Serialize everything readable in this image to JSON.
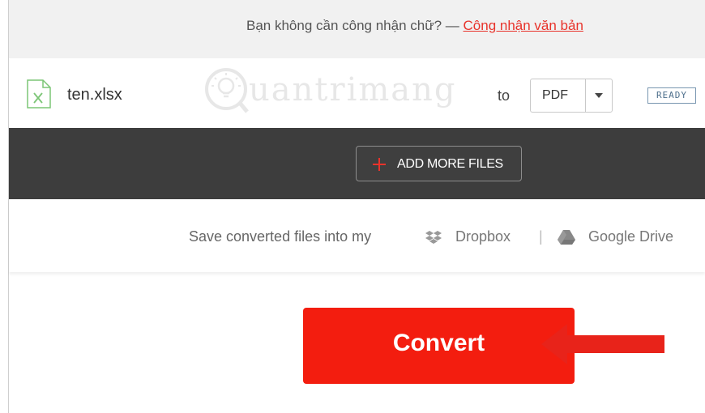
{
  "ocr_banner": {
    "text": "Bạn không cần công nhận chữ? — ",
    "link": "Công nhận văn bản"
  },
  "file": {
    "name": "ten.xlsx",
    "icon": "excel-file-icon",
    "to_label": "to",
    "format": "PDF",
    "status": "READY"
  },
  "toolbar": {
    "add_more_label": "ADD MORE FILES"
  },
  "save": {
    "text": "Save converted files into my",
    "dropbox": "Dropbox",
    "separator": "|",
    "gdrive": "Google Drive"
  },
  "convert": {
    "label": "Convert"
  },
  "watermark": {
    "text": "uantrimang"
  },
  "colors": {
    "accent": "#f31d0f",
    "dark_bar": "#3d3d3d",
    "excel_green": "#7cc576",
    "status_blue": "#4e6f8c"
  }
}
